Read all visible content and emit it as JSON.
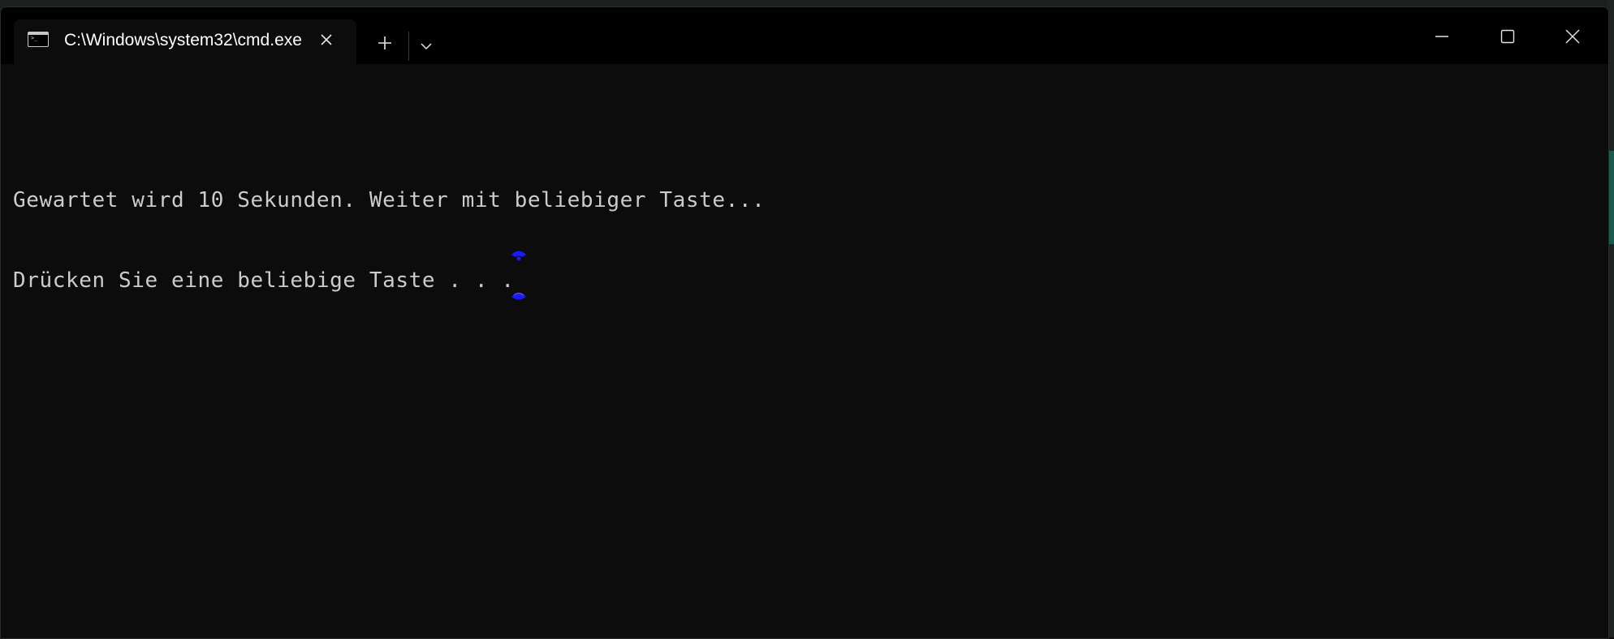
{
  "window": {
    "tab_title": "C:\\Windows\\system32\\cmd.exe",
    "tab_icon": "cmd-icon",
    "new_tab_icon": "plus-icon",
    "dropdown_icon": "chevron-down-icon",
    "controls": {
      "minimize_icon": "minimize-icon",
      "maximize_icon": "maximize-icon",
      "close_icon": "close-icon"
    }
  },
  "terminal": {
    "lines": [
      "Gewartet wird 10 Sekunden. Weiter mit beliebiger Taste...",
      "Drücken Sie eine beliebige Taste . . ."
    ],
    "caret_color": "#1a1aff"
  },
  "colors": {
    "background": "#0c0c0c",
    "text": "#cccccc",
    "titlebar": "#000000"
  }
}
